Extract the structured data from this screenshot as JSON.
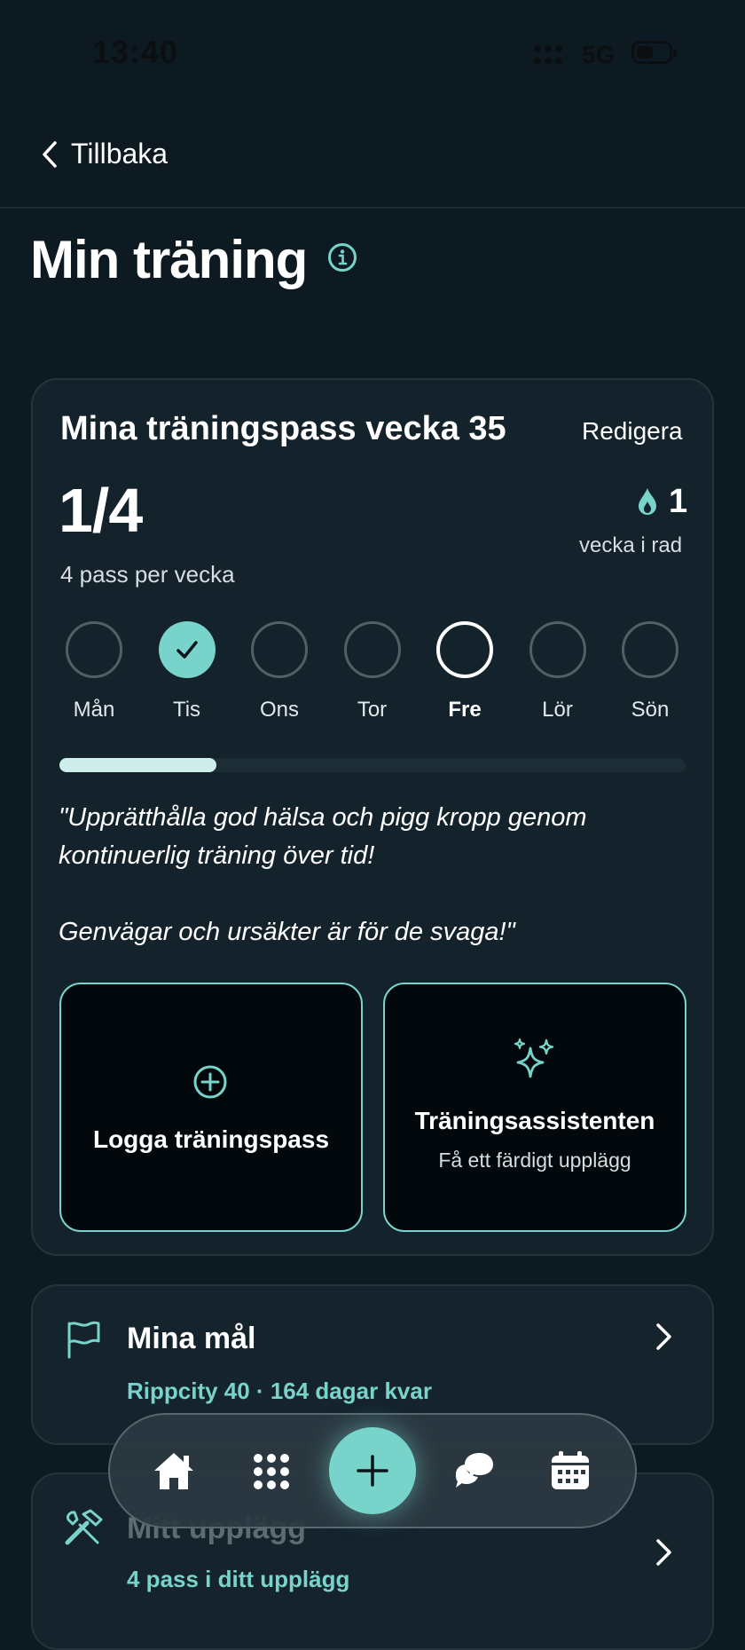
{
  "status_bar": {
    "time": "13:40",
    "network": "5G"
  },
  "nav": {
    "back_label": "Tillbaka"
  },
  "page": {
    "title": "Min träning"
  },
  "weekly_card": {
    "title": "Mina träningspass vecka 35",
    "edit_label": "Redigera",
    "count": "1/4",
    "per_week": "4 pass per vecka",
    "streak_value": "1",
    "streak_label": "vecka i rad",
    "progress": 0.25,
    "days": [
      {
        "label": "Mån",
        "state": "empty"
      },
      {
        "label": "Tis",
        "state": "done"
      },
      {
        "label": "Ons",
        "state": "empty"
      },
      {
        "label": "Tor",
        "state": "empty"
      },
      {
        "label": "Fre",
        "state": "today"
      },
      {
        "label": "Lör",
        "state": "empty"
      },
      {
        "label": "Sön",
        "state": "empty"
      }
    ],
    "quote_line1": "\"Upprätthålla god hälsa och pigg kropp genom",
    "quote_line2": "kontinuerlig träning över tid!",
    "quote_line3": "Genvägar och ursäkter är för de svaga!\"",
    "log_button": "Logga träningspass",
    "assistant_title": "Träningsassistenten",
    "assistant_subtitle": "Få ett färdigt upplägg"
  },
  "goals": {
    "title": "Mina mål",
    "subtitle": "Rippcity 40 · 164 dagar kvar"
  },
  "plan": {
    "title": "Mitt upplägg",
    "subtitle": "4 pass i ditt upplägg"
  },
  "bottom_nav": {
    "items": [
      "home-icon",
      "grid-icon",
      "add-icon",
      "chat-icon",
      "calendar-icon"
    ]
  },
  "colors": {
    "accent": "#78d3cb",
    "background": "#0e1a22",
    "card": "#13222b"
  }
}
